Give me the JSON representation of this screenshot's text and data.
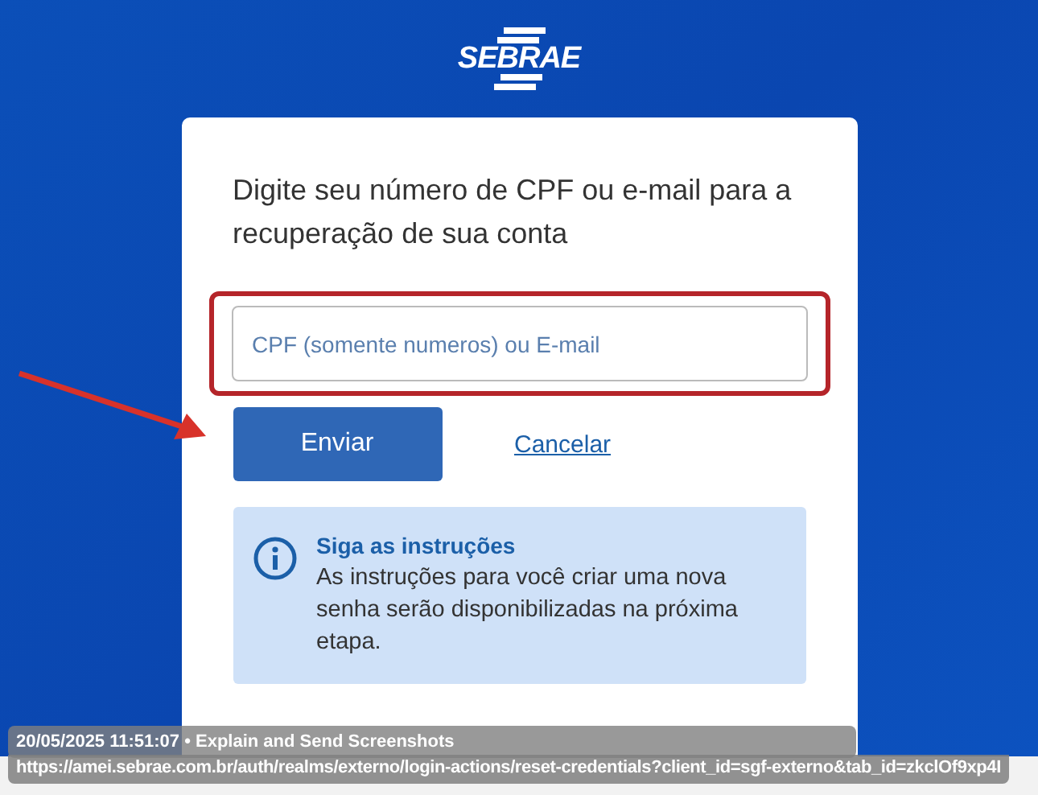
{
  "logo": {
    "text": "SEBRAE"
  },
  "card": {
    "title": "Digite seu número de CPF ou e-mail para a recuperação de sua conta",
    "field": {
      "placeholder": "CPF (somente numeros) ou E-mail"
    },
    "submit_button": "Enviar",
    "cancel_link": "Cancelar",
    "info": {
      "title": "Siga as instruções",
      "body": "As instruções para você criar uma nova senha serão disponibilizadas na próxima etapa."
    }
  },
  "overlay": {
    "caption": "20/05/2025 11:51:07 • Explain and Send Screenshots",
    "url": "https://amei.sebrae.com.br/auth/realms/externo/login-actions/reset-credentials?client_id=sgf-externo&tab_id=zkclOf9xp4I"
  }
}
